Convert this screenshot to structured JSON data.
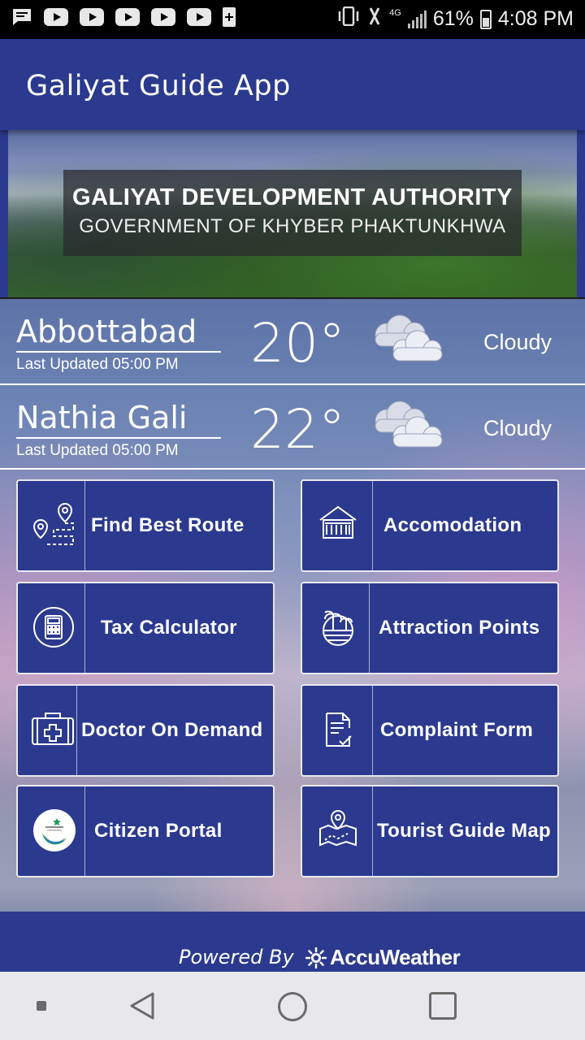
{
  "status_bar": {
    "network": "4G",
    "battery_percent": "61%",
    "time": "4:08 PM",
    "left_icons": [
      "message-icon",
      "youtube-icon",
      "youtube-icon",
      "youtube-icon",
      "youtube-icon",
      "youtube-icon",
      "battery-plus-icon"
    ]
  },
  "app_bar": {
    "title": "Galiyat Guide App"
  },
  "banner": {
    "title": "GALIYAT DEVELOPMENT AUTHORITY",
    "subtitle": "GOVERNMENT OF KHYBER PHAKTUNKHWA"
  },
  "weather": [
    {
      "city": "Abbottabad",
      "updated": "Last Updated 05:00 PM",
      "temp": "20°",
      "condition": "Cloudy",
      "icon": "cloud-icon"
    },
    {
      "city": "Nathia Gali",
      "updated": "Last Updated 05:00 PM",
      "temp": "22°",
      "condition": "Cloudy",
      "icon": "cloud-icon"
    }
  ],
  "tiles": [
    {
      "label": "Find Best Route",
      "icon": "route-icon"
    },
    {
      "label": "Accomodation",
      "icon": "house-icon"
    },
    {
      "label": "Tax Calculator",
      "icon": "calculator-icon"
    },
    {
      "label": "Attraction Points",
      "icon": "palm-island-icon"
    },
    {
      "label": "Doctor On Demand",
      "icon": "medical-kit-icon"
    },
    {
      "label": "Complaint Form",
      "icon": "form-check-icon"
    },
    {
      "label": "Citizen Portal",
      "icon": "citizen-portal-logo"
    },
    {
      "label": "Tourist Guide Map",
      "icon": "map-pin-icon"
    }
  ],
  "footer": {
    "powered_by": "Powered By",
    "brand": "AccuWeather"
  },
  "colors": {
    "primary": "#2b3a8f",
    "white": "#ffffff"
  }
}
